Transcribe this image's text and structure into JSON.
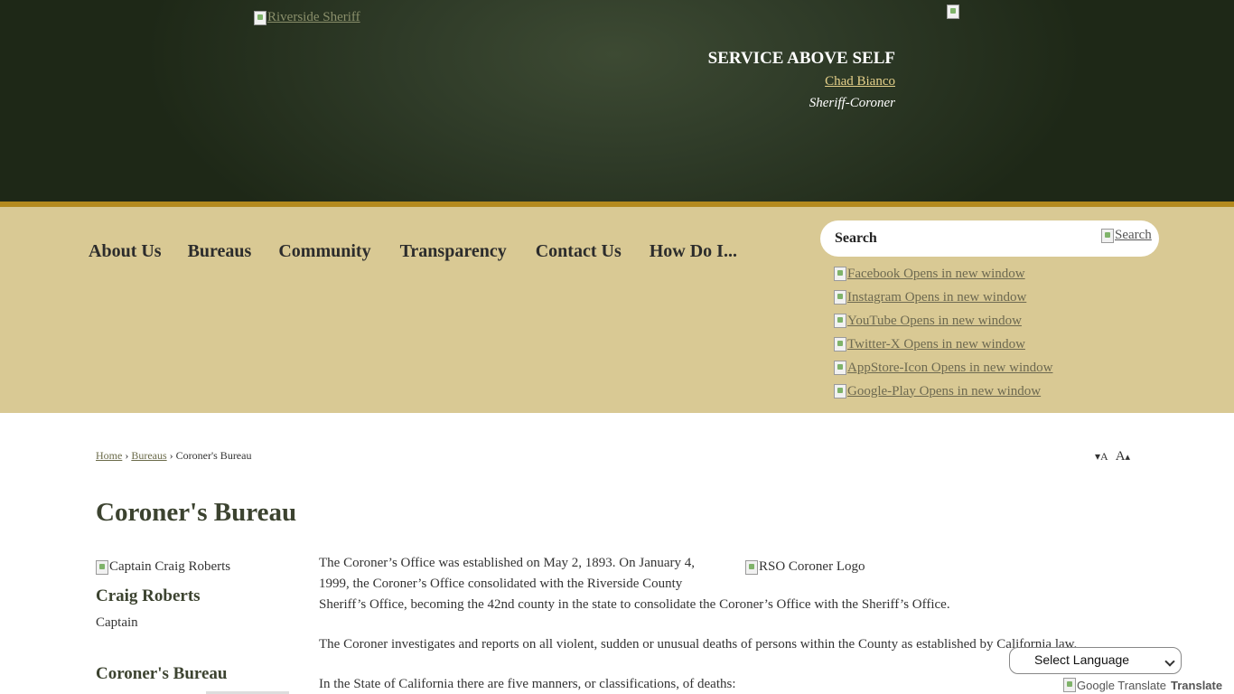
{
  "header": {
    "logo_alt": "Riverside Sheriff",
    "tagline": "SERVICE ABOVE SELF",
    "sheriff_name": "Chad Bianco",
    "sheriff_title": "Sheriff-Coroner"
  },
  "nav": {
    "items": [
      "About Us",
      "Bureaus",
      "Community",
      "Transparency",
      "Contact Us",
      "How Do I..."
    ]
  },
  "search": {
    "label": "Search",
    "button_alt": "Search"
  },
  "social": [
    {
      "label": "Facebook Opens in new window",
      "icon": "facebook-icon"
    },
    {
      "label": "Instagram Opens in new window",
      "icon": "instagram-icon"
    },
    {
      "label": "YouTube Opens in new window",
      "icon": "youtube-icon"
    },
    {
      "label": "Twitter-X Opens in new window",
      "icon": "twitter-x-icon"
    },
    {
      "label": "AppStore-Icon Opens in new window",
      "icon": "appstore-icon"
    },
    {
      "label": "Google-Play Opens in new window",
      "icon": "google-play-icon"
    }
  ],
  "breadcrumb": {
    "home": "Home",
    "bureaus": "Bureaus",
    "current": "Coroner's Bureau",
    "separator": "›"
  },
  "font_tools": {
    "decrease": "A",
    "increase": "A"
  },
  "page": {
    "title": "Coroner's Bureau"
  },
  "sidebar": {
    "photo_alt": "Captain Craig Roberts",
    "name": "Craig Roberts",
    "role": "Captain",
    "section_title": "Coroner's Bureau"
  },
  "content": {
    "logo_alt": "RSO Coroner Logo",
    "p1a": "The Coroner’s Office was established on May 2, 1893. On January 4, 1999, the Coroner’s Office consolidated with the Riverside County",
    "p1b": "Sheriff’s Office, becoming the 42nd county in the state to consolidate the Coroner’s Office with the Sheriff’s Office.",
    "p2": "The Coroner investigates and reports on all violent, sudden or unusual deaths of persons within the County as established by California law.",
    "p3": "In the State of California there are five manners, or classifications, of deaths:"
  },
  "translate": {
    "select_label": "Select Language",
    "brand_alt": "Google Translate",
    "brand_word": "Translate"
  },
  "colors": {
    "header_bg": "#2f3b28",
    "gold_stripe": "#b48a1e",
    "nav_band": "#d9c994",
    "title_green": "#3c4330"
  }
}
